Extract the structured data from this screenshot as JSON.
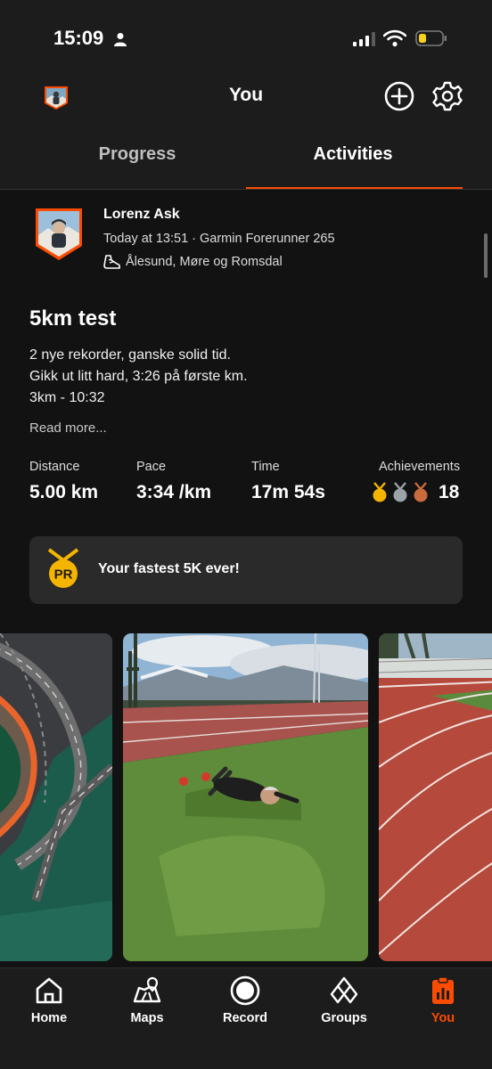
{
  "status_bar": {
    "time": "15:09"
  },
  "header": {
    "title": "You"
  },
  "tabs": [
    {
      "label": "Progress"
    },
    {
      "label": "Activities"
    }
  ],
  "activity": {
    "athlete": "Lorenz Ask",
    "meta": "Today at 13:51 · Garmin Forerunner 265",
    "location": "Ålesund, Møre og Romsdal",
    "title": "5km test",
    "description": [
      "2 nye rekorder, ganske solid tid.",
      "Gikk ut litt hard, 3:26 på første km.",
      "3km - 10:32"
    ],
    "read_more": "Read more...",
    "stats": {
      "distance": {
        "label": "Distance",
        "value": "5.00 km"
      },
      "pace": {
        "label": "Pace",
        "value": "3:34 /km"
      },
      "time": {
        "label": "Time",
        "value": "17m 54s"
      },
      "achievements": {
        "label": "Achievements",
        "value": "18"
      }
    },
    "pr": {
      "badge": "PR",
      "text": "Your fastest 5K ever!"
    }
  },
  "nav": [
    {
      "label": "Home"
    },
    {
      "label": "Maps"
    },
    {
      "label": "Record"
    },
    {
      "label": "Groups"
    },
    {
      "label": "You"
    }
  ],
  "colors": {
    "accent": "#fc4c02",
    "background": "#121212",
    "surface": "#1c1c1c",
    "card": "#2a2a2a",
    "gold": "#f5b400",
    "silver": "#9aa3a8",
    "bronze": "#c96b3a"
  }
}
